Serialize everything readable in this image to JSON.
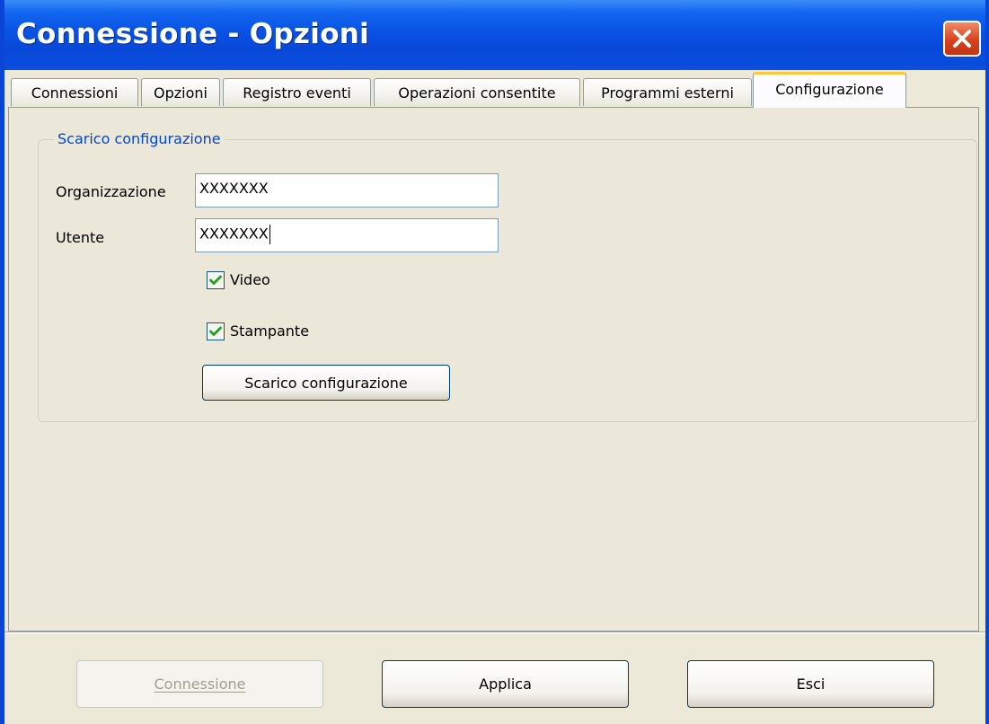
{
  "window": {
    "title": "Connessione - Opzioni"
  },
  "tabs": [
    {
      "label": "Connessioni"
    },
    {
      "label": "Opzioni"
    },
    {
      "label": "Registro eventi"
    },
    {
      "label": "Operazioni consentite"
    },
    {
      "label": "Programmi esterni"
    },
    {
      "label": "Configurazione",
      "active": true
    }
  ],
  "config_group": {
    "legend": "Scarico configurazione",
    "organization_label": "Organizzazione",
    "organization_value": "XXXXXXX",
    "user_label": "Utente",
    "user_value": "XXXXXXX",
    "video_label": "Video",
    "video_checked": true,
    "printer_label": "Stampante",
    "printer_checked": true,
    "download_button": "Scarico configurazione"
  },
  "footer": {
    "connect_button": "Connessione",
    "connect_enabled": false,
    "apply_button": "Applica",
    "exit_button": "Esci"
  },
  "colors": {
    "titlebar": "#0a52e4",
    "legend_text": "#0046d5",
    "active_tab_accent": "#ffc83c",
    "checkmark": "#21a121",
    "close_button": "#d8431c"
  },
  "icons": {
    "close": "close-icon",
    "checkmark": "checkmark-icon"
  }
}
